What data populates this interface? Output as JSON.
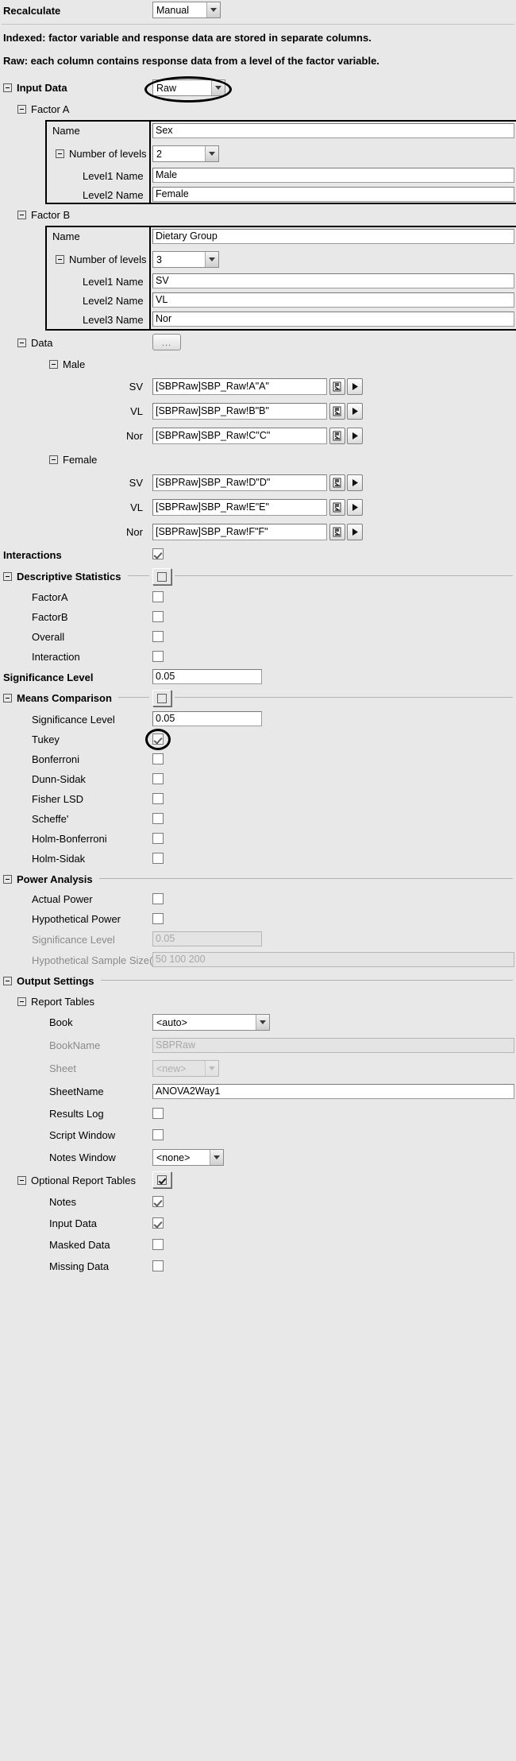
{
  "recalculate": {
    "label": "Recalculate",
    "value": "Manual"
  },
  "description": {
    "line1": "Indexed: factor variable and response data are stored in separate columns.",
    "line2": "Raw: each column contains response data from a level of the factor variable."
  },
  "input_data": {
    "label": "Input Data",
    "value": "Raw",
    "factor_a": {
      "label": "Factor A",
      "name_label": "Name",
      "name_value": "Sex",
      "levels_label": "Number of levels",
      "levels_value": "2",
      "levels": [
        {
          "label": "Level1 Name",
          "value": "Male"
        },
        {
          "label": "Level2 Name",
          "value": "Female"
        }
      ]
    },
    "factor_b": {
      "label": "Factor B",
      "name_label": "Name",
      "name_value": "Dietary Group",
      "levels_label": "Number of levels",
      "levels_value": "3",
      "levels": [
        {
          "label": "Level1 Name",
          "value": "SV"
        },
        {
          "label": "Level2 Name",
          "value": "VL"
        },
        {
          "label": "Level3 Name",
          "value": "Nor"
        }
      ]
    },
    "data": {
      "label": "Data",
      "browse_label": "...",
      "groups": [
        {
          "label": "Male",
          "rows": [
            {
              "label": "SV",
              "value": "[SBPRaw]SBP_Raw!A\"A\""
            },
            {
              "label": "VL",
              "value": "[SBPRaw]SBP_Raw!B\"B\""
            },
            {
              "label": "Nor",
              "value": "[SBPRaw]SBP_Raw!C\"C\""
            }
          ]
        },
        {
          "label": "Female",
          "rows": [
            {
              "label": "SV",
              "value": "[SBPRaw]SBP_Raw!D\"D\""
            },
            {
              "label": "VL",
              "value": "[SBPRaw]SBP_Raw!E\"E\""
            },
            {
              "label": "Nor",
              "value": "[SBPRaw]SBP_Raw!F\"F\""
            }
          ]
        }
      ]
    }
  },
  "interactions": {
    "label": "Interactions",
    "checked": true
  },
  "descriptive_statistics": {
    "label": "Descriptive Statistics",
    "checked": false,
    "items": [
      {
        "label": "FactorA",
        "checked": false
      },
      {
        "label": "FactorB",
        "checked": false
      },
      {
        "label": "Overall",
        "checked": false
      },
      {
        "label": "Interaction",
        "checked": false
      }
    ]
  },
  "significance_level": {
    "label": "Significance Level",
    "value": "0.05"
  },
  "means_comparison": {
    "label": "Means Comparison",
    "checked": false,
    "significance_level": {
      "label": "Significance Level",
      "value": "0.05"
    },
    "methods": [
      {
        "label": "Tukey",
        "checked": true
      },
      {
        "label": "Bonferroni",
        "checked": false
      },
      {
        "label": "Dunn-Sidak",
        "checked": false
      },
      {
        "label": "Fisher LSD",
        "checked": false
      },
      {
        "label": "Scheffe'",
        "checked": false
      },
      {
        "label": "Holm-Bonferroni",
        "checked": false
      },
      {
        "label": "Holm-Sidak",
        "checked": false
      }
    ]
  },
  "power_analysis": {
    "label": "Power Analysis",
    "actual_power": {
      "label": "Actual Power",
      "checked": false
    },
    "hypothetical_power": {
      "label": "Hypothetical Power",
      "checked": false
    },
    "significance_level": {
      "label": "Significance Level",
      "value": "0.05",
      "disabled": true
    },
    "sample_sizes": {
      "label": "Hypothetical Sample Size(s)",
      "value": "50 100 200",
      "disabled": true
    }
  },
  "output_settings": {
    "label": "Output Settings",
    "report_tables": {
      "label": "Report Tables",
      "book": {
        "label": "Book",
        "value": "<auto>"
      },
      "book_name": {
        "label": "BookName",
        "value": "SBPRaw"
      },
      "sheet": {
        "label": "Sheet",
        "value": "<new>"
      },
      "sheet_name": {
        "label": "SheetName",
        "value": "ANOVA2Way1"
      },
      "results_log": {
        "label": "Results Log",
        "checked": false
      },
      "script_window": {
        "label": "Script Window",
        "checked": false
      },
      "notes_window": {
        "label": "Notes Window",
        "value": "<none>"
      }
    },
    "optional_report_tables": {
      "label": "Optional Report Tables",
      "checked": true,
      "items": [
        {
          "label": "Notes",
          "checked": true
        },
        {
          "label": "Input Data",
          "checked": true
        },
        {
          "label": "Masked Data",
          "checked": false
        },
        {
          "label": "Missing Data",
          "checked": false
        }
      ]
    }
  }
}
